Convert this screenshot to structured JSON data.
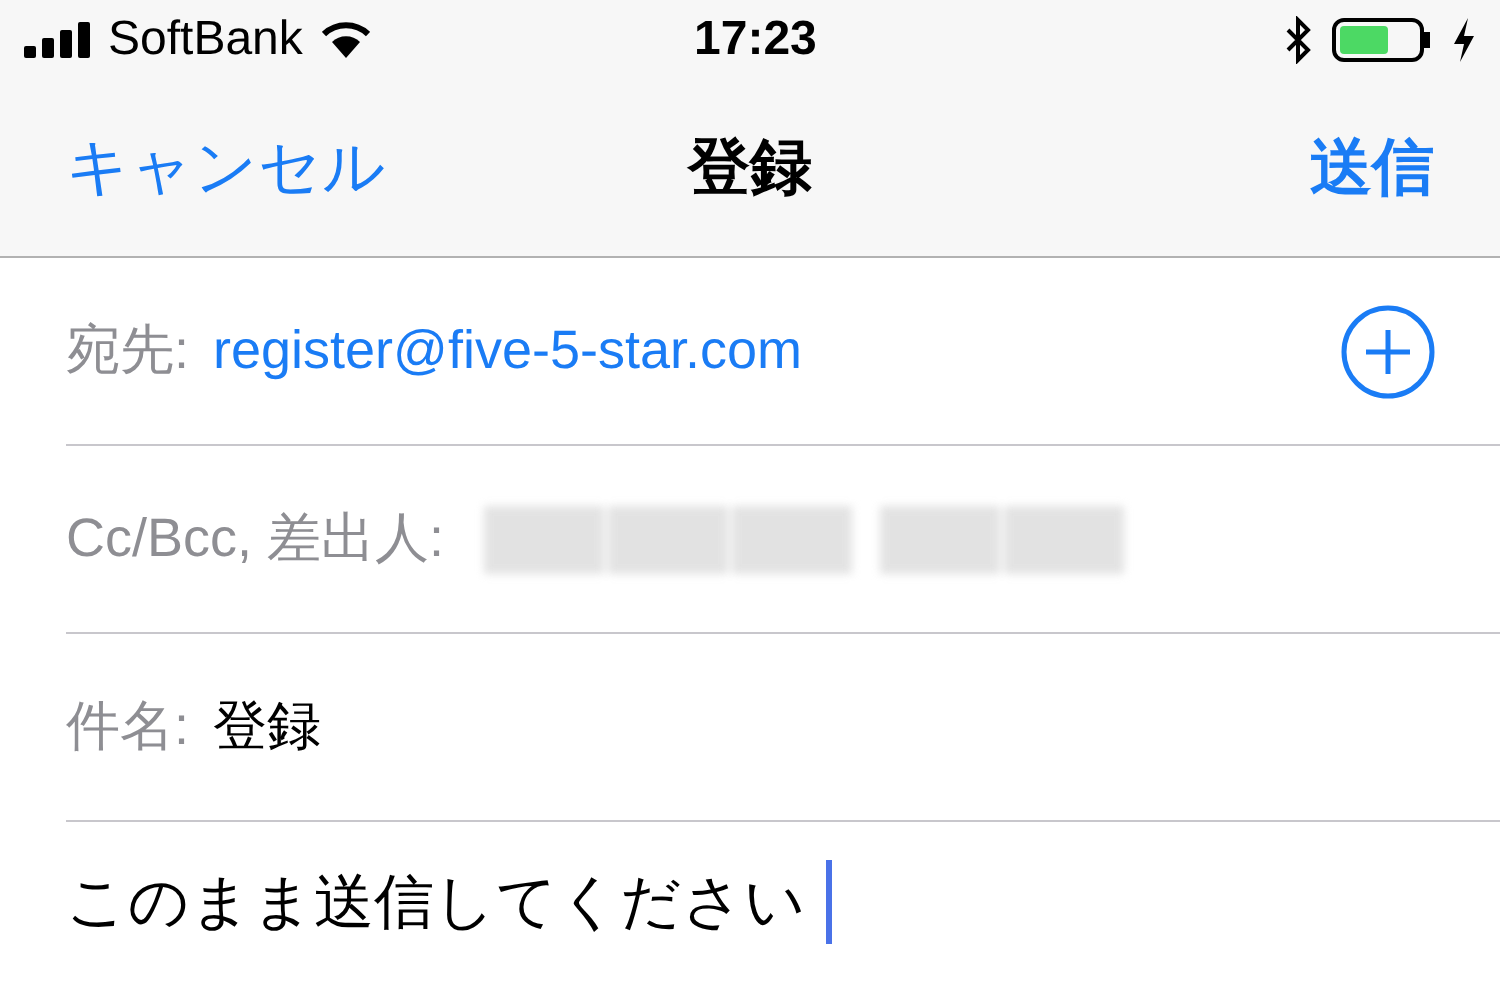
{
  "status_bar": {
    "carrier": "SoftBank",
    "time": "17:23"
  },
  "nav": {
    "cancel": "キャンセル",
    "title": "登録",
    "send": "送信"
  },
  "fields": [
    {
      "kind": "to",
      "label": "宛先:",
      "value": "register@five-5-star.com"
    },
    {
      "kind": "redacted",
      "label": "Cc/Bcc, 差出人:"
    },
    {
      "kind": "plain",
      "label": "件名:",
      "value": "登録"
    }
  ],
  "body": {
    "value": "このまま送信してください"
  }
}
